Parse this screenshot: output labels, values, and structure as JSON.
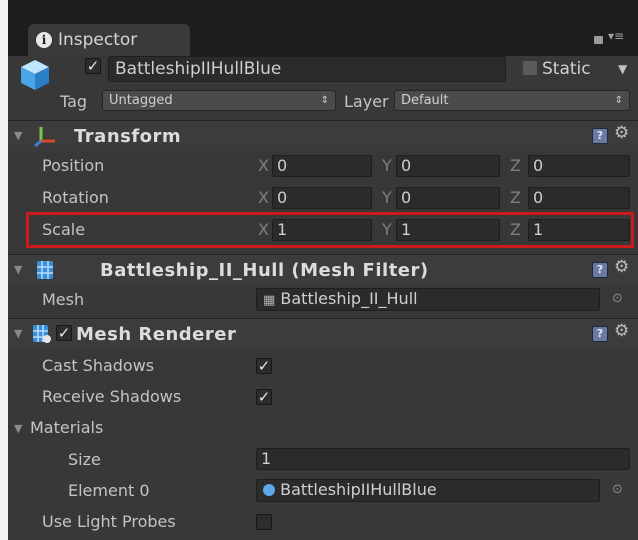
{
  "tab": {
    "title": "Inspector"
  },
  "object": {
    "name": "BattleshipIIHullBlue",
    "active": true,
    "static_label": "Static",
    "static_checked": false
  },
  "tag": {
    "label": "Tag",
    "value": "Untagged"
  },
  "layer": {
    "label": "Layer",
    "value": "Default"
  },
  "transform": {
    "title": "Transform",
    "rows": [
      {
        "label": "Position",
        "x": "0",
        "y": "0",
        "z": "0"
      },
      {
        "label": "Rotation",
        "x": "0",
        "y": "0",
        "z": "0"
      },
      {
        "label": "Scale",
        "x": "1",
        "y": "1",
        "z": "1"
      }
    ],
    "axis_labels": {
      "x": "X",
      "y": "Y",
      "z": "Z"
    },
    "highlight_color": "#cc1a1a"
  },
  "mesh_filter": {
    "title": "Battleship_II_Hull (Mesh Filter)",
    "mesh_label": "Mesh",
    "mesh_value": "Battleship_II_Hull"
  },
  "mesh_renderer": {
    "title": "Mesh Renderer",
    "enabled": true,
    "cast_shadows_label": "Cast Shadows",
    "cast_shadows": true,
    "receive_shadows_label": "Receive Shadows",
    "receive_shadows": true,
    "materials_label": "Materials",
    "size_label": "Size",
    "size_value": "1",
    "element0_label": "Element 0",
    "element0_value": "BattleshipIIHullBlue",
    "light_probes_label": "Use Light Probes",
    "light_probes": false
  },
  "icons": {
    "help": "?",
    "gear": "⚙",
    "checkmark": "✓"
  }
}
